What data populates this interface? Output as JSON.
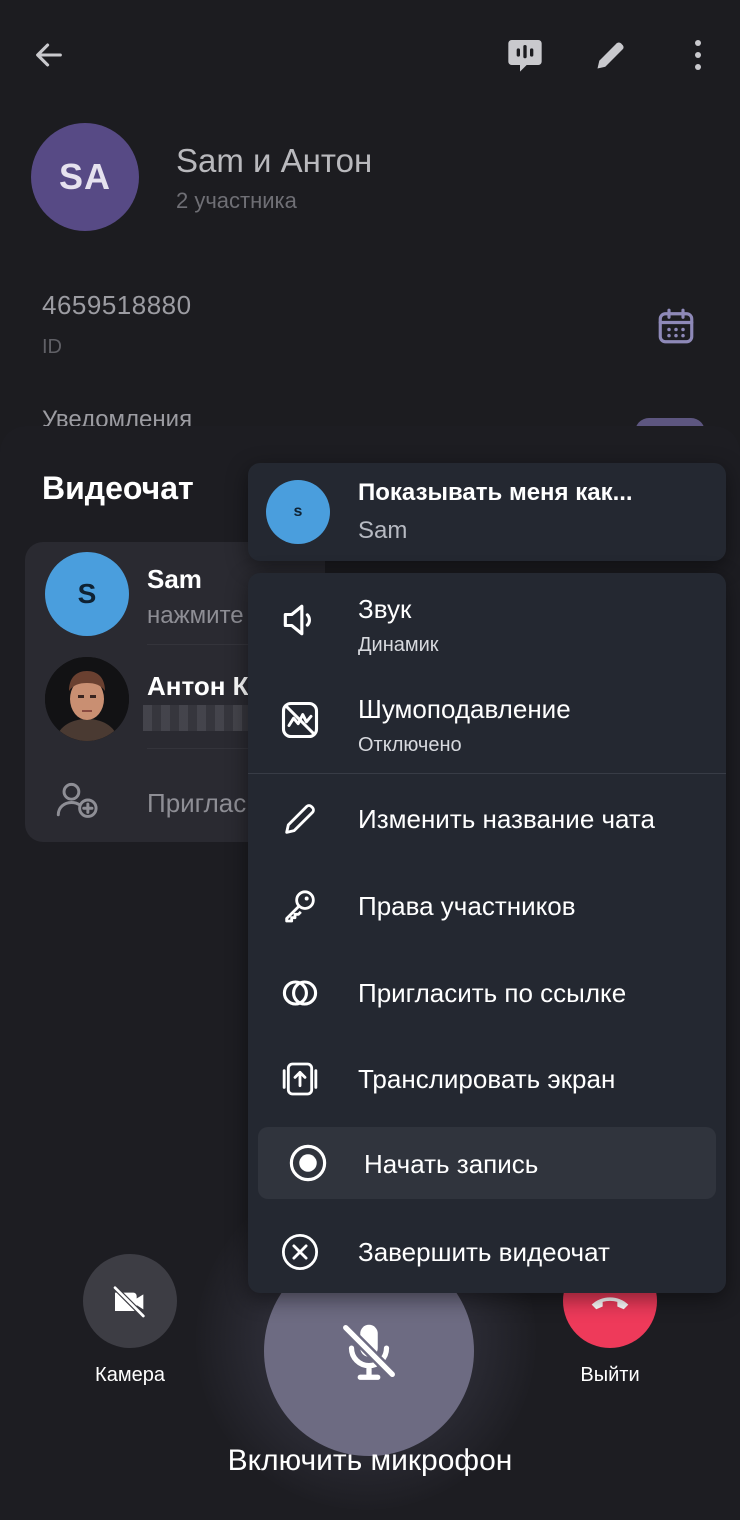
{
  "profile": {
    "avatar_initials": "SA",
    "title": "Sam и Антон",
    "subtitle": "2 участника",
    "id_value": "4659518880",
    "id_label": "ID",
    "notifications_label": "Уведомления"
  },
  "sheet": {
    "title": "Видеочат",
    "participants": [
      {
        "initial": "S",
        "name": "Sam",
        "status": "нажмите"
      },
      {
        "name": "Антон К",
        "status": ""
      }
    ],
    "invite_label": "Приглас"
  },
  "identity_menu": {
    "avatar_initial": "s",
    "title": "Показывать меня как...",
    "value": "Sam"
  },
  "options_menu": {
    "sound": {
      "label": "Звук",
      "sub": "Динамик"
    },
    "noise": {
      "label": "Шумоподавление",
      "sub": "Отключено"
    },
    "items": [
      {
        "label": "Изменить название чата"
      },
      {
        "label": "Права участников"
      },
      {
        "label": "Пригласить по ссылке"
      },
      {
        "label": "Транслировать экран"
      },
      {
        "label": "Начать запись"
      },
      {
        "label": "Завершить видеочат"
      }
    ]
  },
  "controls": {
    "camera_label": "Камера",
    "leave_label": "Выйти",
    "mic_label": "Включить микрофон"
  },
  "colors": {
    "accent_purple": "#574a85",
    "avatar_blue": "#4a9edd",
    "leave_red": "#ee3a5a",
    "mic_button": "#6d6b82",
    "menu_background": "#242831"
  }
}
